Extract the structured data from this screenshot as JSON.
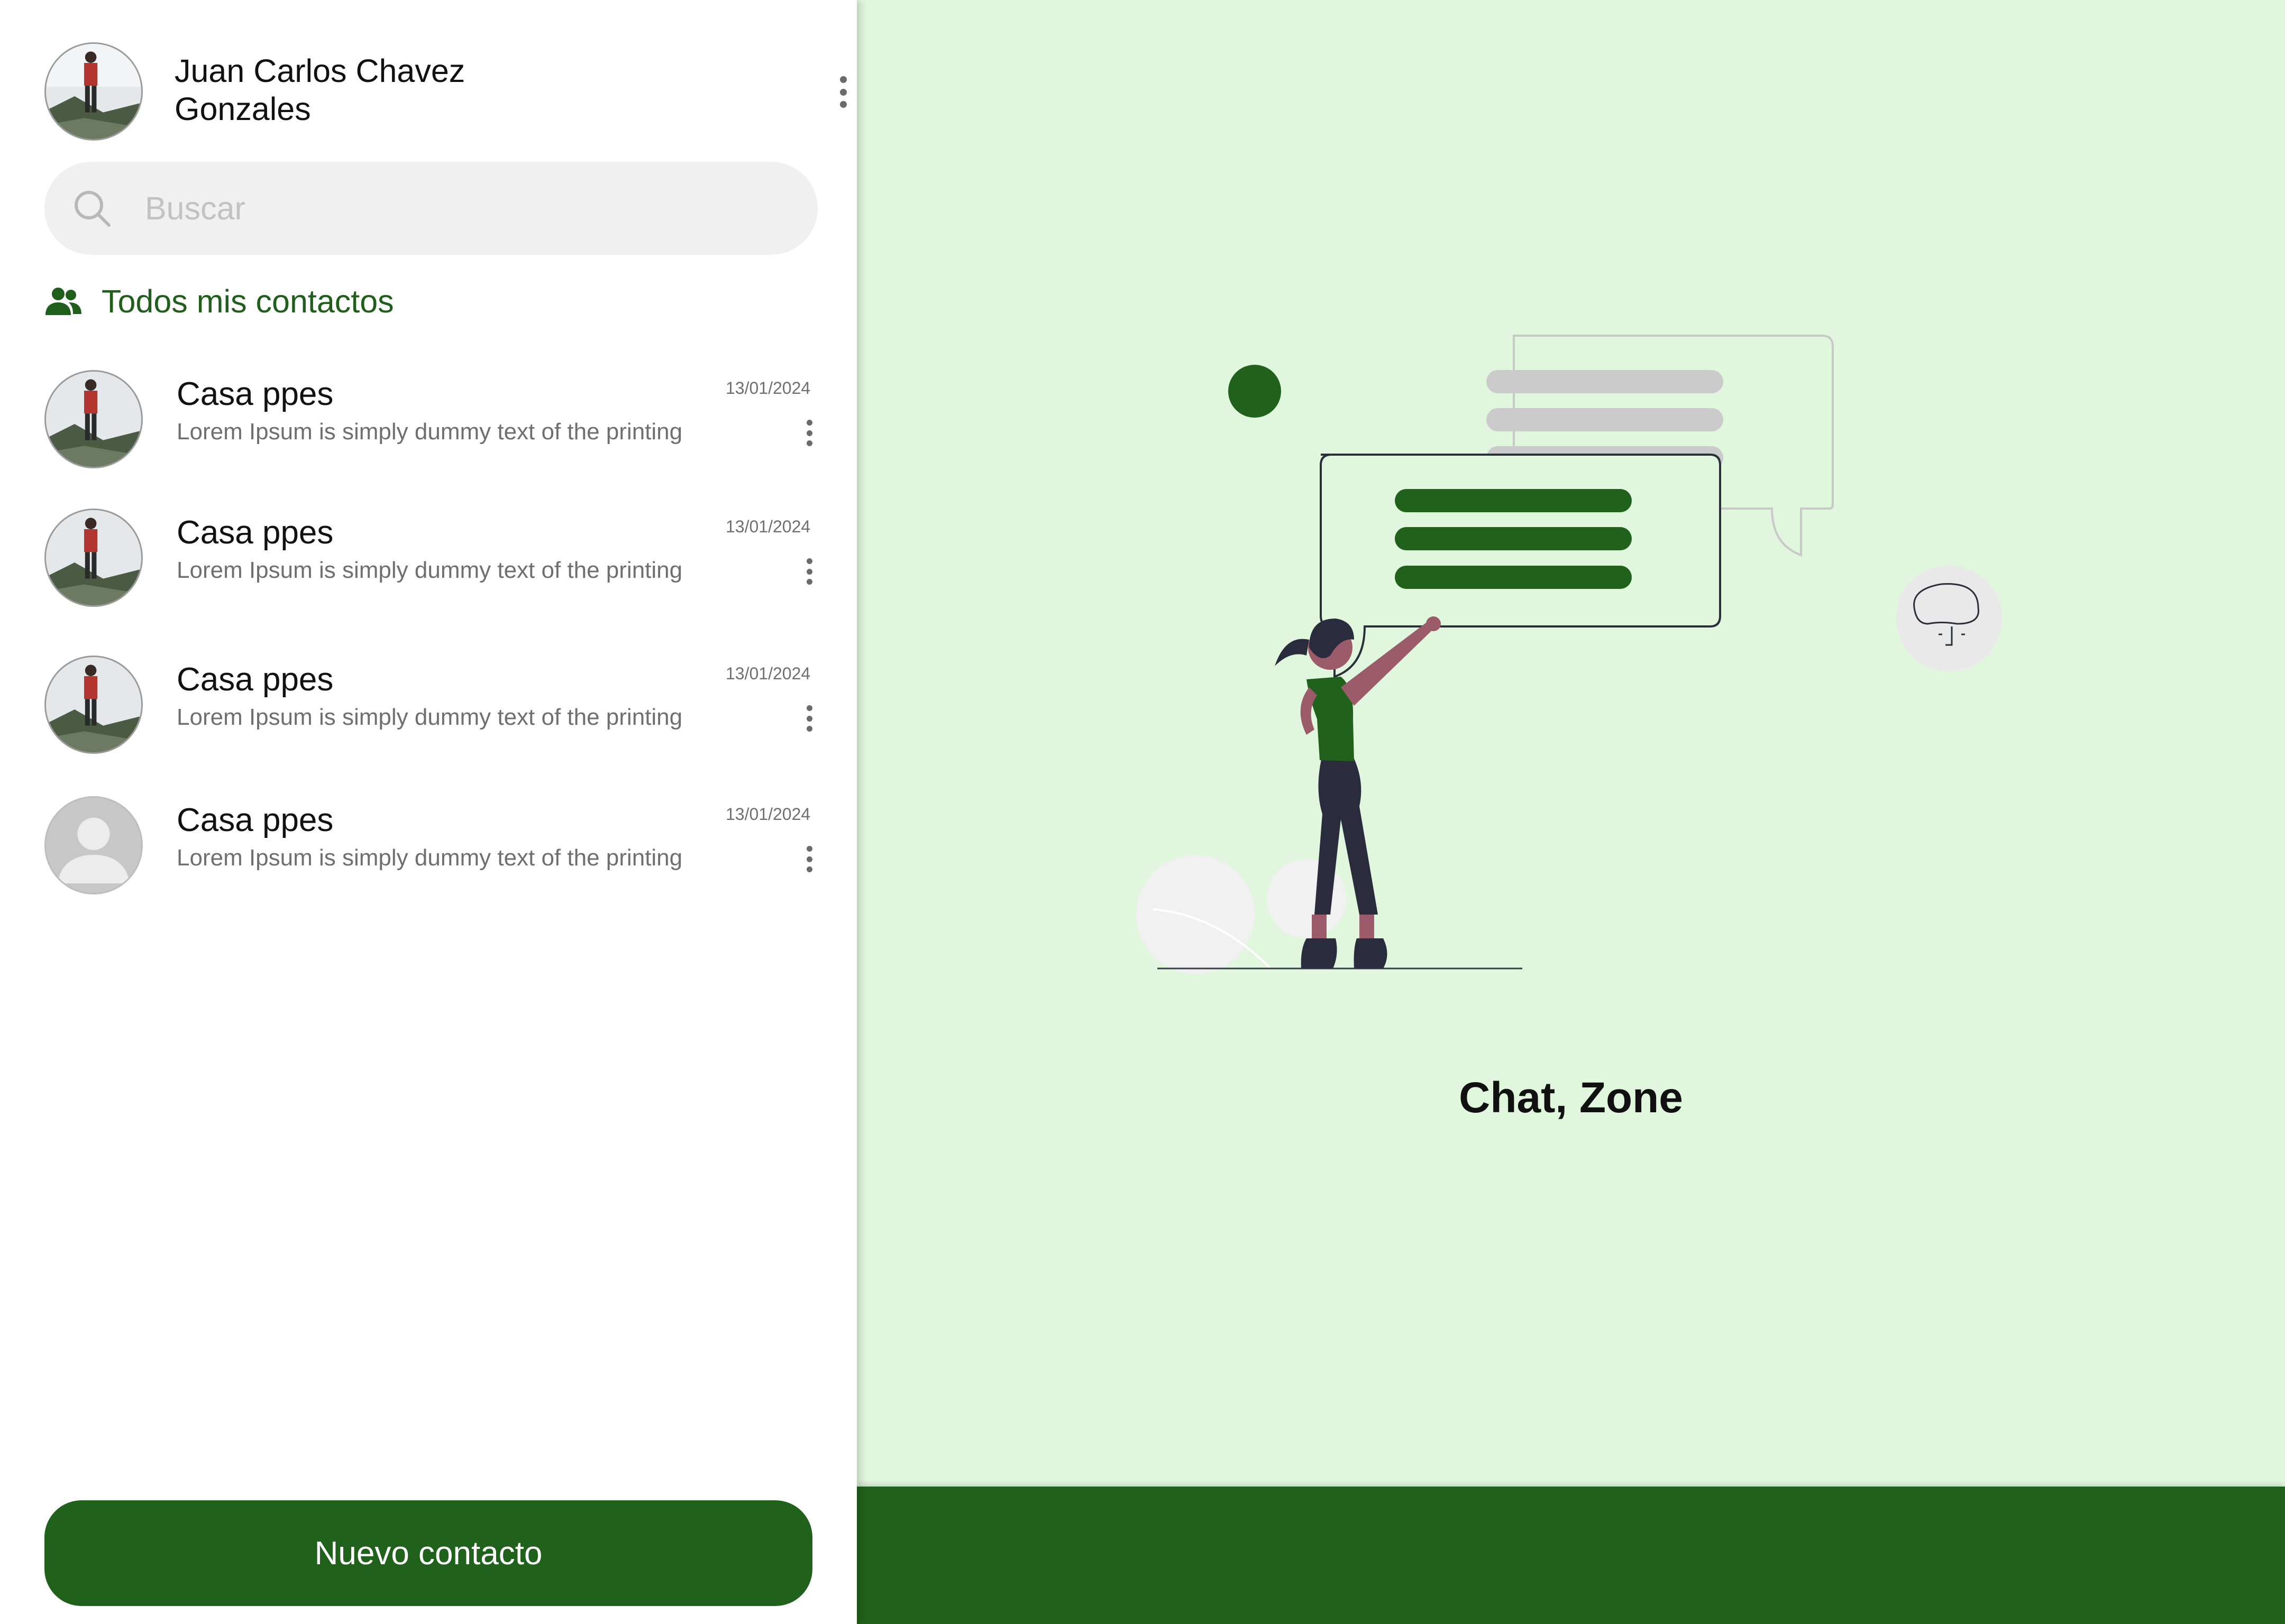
{
  "profile": {
    "name": "Juan Carlos Chavez\nGonzales",
    "menu_icon": "kebab-vertical-icon"
  },
  "search": {
    "placeholder": "Buscar",
    "value": "",
    "icon": "search-icon"
  },
  "section": {
    "icon": "group-people-icon",
    "title": "Todos mis contactos"
  },
  "contacts": [
    {
      "name": "Casa ppes",
      "message": "Lorem Ipsum is simply dummy text of the printing",
      "date": "13/01/2024",
      "avatar": "photo"
    },
    {
      "name": "Casa ppes",
      "message": "Lorem Ipsum is simply dummy text of the printing",
      "date": "13/01/2024",
      "avatar": "photo"
    },
    {
      "name": "Casa ppes",
      "message": "Lorem Ipsum is simply dummy text of the printing",
      "date": "13/01/2024",
      "avatar": "photo"
    },
    {
      "name": "Casa ppes",
      "message": "Lorem Ipsum is simply dummy text of the printing",
      "date": "13/01/2024",
      "avatar": "default-user-icon"
    }
  ],
  "new_contact_button": {
    "label": "Nuevo contacto"
  },
  "main": {
    "welcome_title": "Chat, Zone"
  },
  "colors": {
    "brand_green": "#20621c",
    "section_green": "#1f5f1b",
    "main_background": "#e1f7dd",
    "search_background": "#f0f0f0"
  }
}
